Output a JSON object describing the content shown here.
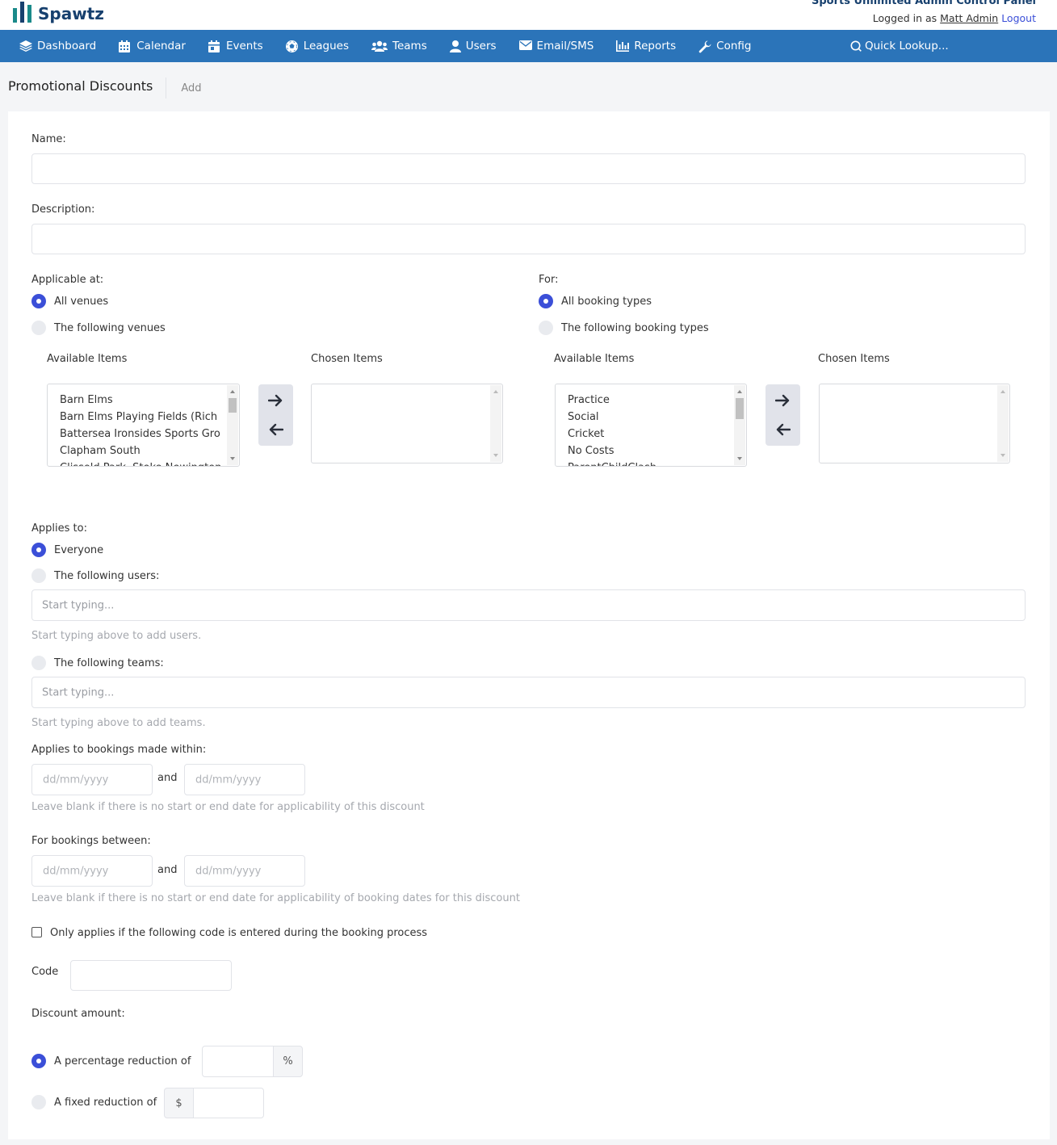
{
  "brand": {
    "name": "Spawtz"
  },
  "header": {
    "panel_title": "Sports Unlimited Admin Control Panel",
    "logged_in_prefix": "Logged in as",
    "user_name": "Matt Admin",
    "logout": "Logout"
  },
  "nav": {
    "items": [
      {
        "label": "Dashboard",
        "icon": "layers-icon"
      },
      {
        "label": "Calendar",
        "icon": "calendar-icon"
      },
      {
        "label": "Events",
        "icon": "calendar-event-icon"
      },
      {
        "label": "Leagues",
        "icon": "ball-icon"
      },
      {
        "label": "Teams",
        "icon": "users-group-icon"
      },
      {
        "label": "Users",
        "icon": "user-icon"
      },
      {
        "label": "Email/SMS",
        "icon": "envelope-icon"
      },
      {
        "label": "Reports",
        "icon": "bar-chart-icon"
      },
      {
        "label": "Config",
        "icon": "wrench-icon"
      }
    ],
    "quick_lookup": "Quick Lookup..."
  },
  "page": {
    "title": "Promotional Discounts",
    "breadcrumb": "Add"
  },
  "form": {
    "name_label": "Name:",
    "name_value": "",
    "description_label": "Description:",
    "description_value": "",
    "applicable_label": "Applicable at:",
    "venue_all": "All venues",
    "venue_following": "The following venues",
    "venue_selected": "all",
    "available_label": "Available Items",
    "chosen_label": "Chosen Items",
    "venues_available": [
      "Barn Elms",
      "Barn Elms Playing Fields (Rich",
      "Battersea Ironsides Sports Gro",
      "Clapham South",
      "Clissold Park, Stoke Newington"
    ],
    "for_label": "For:",
    "booking_all": "All booking types",
    "booking_following": "The following booking types",
    "booking_selected": "all",
    "booking_types_available": [
      "Practice",
      "Social",
      "Cricket",
      "No Costs",
      "ParentChildClash"
    ],
    "applies_to_label": "Applies to:",
    "applies_everyone": "Everyone",
    "applies_users": "The following users:",
    "applies_teams": "The following teams:",
    "applies_selected": "everyone",
    "users_placeholder": "Start typing...",
    "users_hint": "Start typing above to add users.",
    "teams_placeholder": "Start typing...",
    "teams_hint": "Start typing above to add teams.",
    "made_within_label": "Applies to bookings made within:",
    "date_placeholder": "dd/mm/yyyy",
    "and": "and",
    "made_within_hint": "Leave blank if there is no start or end date for applicability of this discount",
    "between_label": "For bookings between:",
    "between_hint": "Leave blank if there is no start or end date for applicability of booking dates for this discount",
    "code_only_label": "Only applies if the following code is entered during the booking process",
    "code_only_checked": false,
    "code_label": "Code",
    "code_value": "",
    "discount_label": "Discount amount:",
    "percentage_label": "A percentage reduction of",
    "percent_symbol": "%",
    "fixed_label": "A fixed reduction of",
    "currency_symbol": "$",
    "discount_selected": "percentage"
  }
}
